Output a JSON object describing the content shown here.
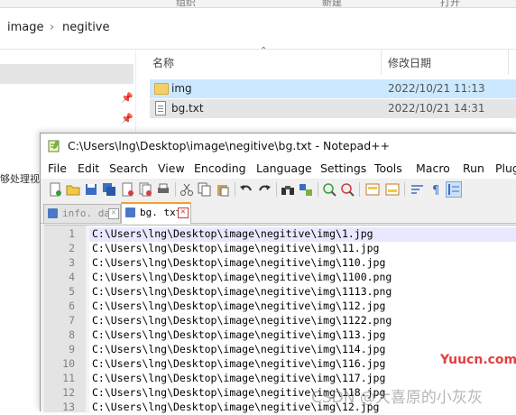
{
  "ribbon": {
    "labels": [
      "组织",
      "新建",
      "打开"
    ]
  },
  "address": {
    "breadcrumbs": [
      "image",
      "negitive"
    ],
    "separator": "›"
  },
  "nav_cutoff_text": "够处理视频",
  "file_list": {
    "columns": {
      "name": "名称",
      "date": "修改日期"
    },
    "rows": [
      {
        "name": "img",
        "date": "2022/10/21 11:13",
        "type": "folder",
        "state": "selected"
      },
      {
        "name": "bg.txt",
        "date": "2022/10/21 14:31",
        "type": "text-file",
        "state": "hover"
      }
    ]
  },
  "notepad": {
    "title": "C:\\Users\\lng\\Desktop\\image\\negitive\\bg.txt - Notepad++",
    "menu": [
      "File",
      "Edit",
      "Search",
      "View",
      "Encoding",
      "Language",
      "Settings",
      "Tools",
      "Macro",
      "Run",
      "Plug"
    ],
    "tabs": [
      {
        "label": "info. dat",
        "active": false,
        "close": "✕"
      },
      {
        "label": "bg. txt",
        "active": true,
        "close": "✕"
      }
    ],
    "lines": [
      {
        "n": "1",
        "text": "C:\\Users\\lng\\Desktop\\image\\negitive\\img\\1.jpg"
      },
      {
        "n": "2",
        "text": "C:\\Users\\lng\\Desktop\\image\\negitive\\img\\11.jpg"
      },
      {
        "n": "3",
        "text": "C:\\Users\\lng\\Desktop\\image\\negitive\\img\\110.jpg"
      },
      {
        "n": "4",
        "text": "C:\\Users\\lng\\Desktop\\image\\negitive\\img\\1100.png"
      },
      {
        "n": "5",
        "text": "C:\\Users\\lng\\Desktop\\image\\negitive\\img\\1113.png"
      },
      {
        "n": "6",
        "text": "C:\\Users\\lng\\Desktop\\image\\negitive\\img\\112.jpg"
      },
      {
        "n": "7",
        "text": "C:\\Users\\lng\\Desktop\\image\\negitive\\img\\1122.png"
      },
      {
        "n": "8",
        "text": "C:\\Users\\lng\\Desktop\\image\\negitive\\img\\113.jpg"
      },
      {
        "n": "9",
        "text": "C:\\Users\\lng\\Desktop\\image\\negitive\\img\\114.jpg"
      },
      {
        "n": "10",
        "text": "C:\\Users\\lng\\Desktop\\image\\negitive\\img\\116.jpg"
      },
      {
        "n": "11",
        "text": "C:\\Users\\lng\\Desktop\\image\\negitive\\img\\117.jpg"
      },
      {
        "n": "12",
        "text": "C:\\Users\\lng\\Desktop\\image\\negitive\\img\\118.jpg"
      },
      {
        "n": "13",
        "text": "C:\\Users\\lng\\Desktop\\image\\negitive\\img\\12.jpg"
      }
    ]
  },
  "watermarks": {
    "site": "Yuucn.com",
    "author": "CSDN @大喜原的小灰灰"
  },
  "colors": {
    "selection": "#cce8ff",
    "hover": "#e5e5e5",
    "current_line": "#e8e8ff",
    "gutter": "#e4e4e4",
    "close_red": "#c04040"
  }
}
